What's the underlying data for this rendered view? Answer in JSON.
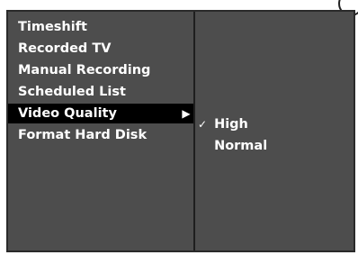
{
  "menu": {
    "items": [
      {
        "label": "Timeshift"
      },
      {
        "label": "Recorded TV"
      },
      {
        "label": "Manual Recording"
      },
      {
        "label": "Scheduled List"
      },
      {
        "label": "Video Quality",
        "selected": true,
        "arrow": "▶"
      },
      {
        "label": "Format Hard Disk"
      }
    ]
  },
  "submenu": {
    "title": "Video Quality",
    "options": [
      {
        "label": "High",
        "checked": true,
        "check_mark": "✓"
      },
      {
        "label": "Normal",
        "checked": false
      }
    ]
  },
  "colors": {
    "panel_background": "#4d4d4d",
    "selection_highlight": "#000000",
    "text": "#ffffff",
    "frame_border": "#2a2a2a"
  },
  "icons": {
    "submenu_arrow": "right-triangle-icon",
    "checked_option": "checkmark-icon"
  }
}
